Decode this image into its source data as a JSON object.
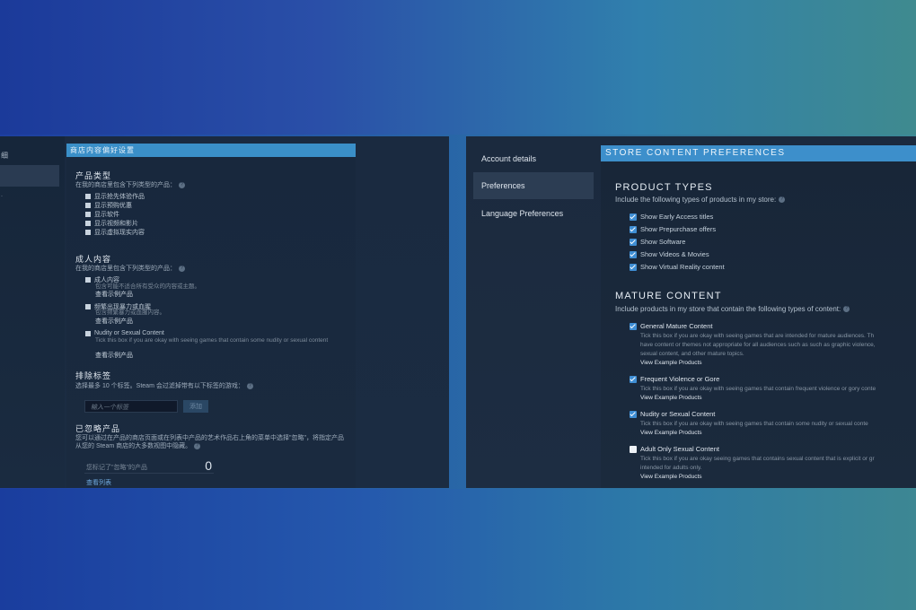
{
  "left_panel": {
    "sidebar_frags": [
      "细",
      "",
      ""
    ],
    "header": "商店内容偏好设置",
    "product_types": {
      "title": "产品类型",
      "subtitle": "在我的商店里包含下列类型的产品：",
      "items": [
        "显示抢先体验作品",
        "显示预购优惠",
        "显示软件",
        "显示视频和影片",
        "显示虚拟现实内容"
      ]
    },
    "mature": {
      "title": "成人内容",
      "subtitle": "在我的商店里包含下列类型的产品：",
      "items": [
        {
          "label": "成人内容",
          "desc": "包含可能不适合所有受众的内容或主题。",
          "link": "查看示例产品"
        },
        {
          "label": "频繁出现暴力或血腥",
          "desc": "包含频繁暴力或血腥内容。",
          "link": "查看示例产品"
        },
        {
          "label": "Nudity or Sexual Content",
          "desc": "Tick this box if you are okay with seeing games that contain some nudity or sexual content",
          "link": "查看示例产品"
        }
      ]
    },
    "excluded_tags": {
      "title": "排除标签",
      "subtitle": "选择最多 10 个标签。Steam 会过滤掉带有以下标签的游戏：",
      "input_placeholder": "输入一个标签",
      "add_button": "添加"
    },
    "ignored": {
      "title": "已忽略产品",
      "desc": "您可以通过在产品的商店页面或在列表中产品的艺术作品右上角的菜单中选择\"忽略\"，将指定产品从您的 Steam 商店的大多数视图中隐藏。",
      "label": "您标记了\"忽略\"的产品",
      "count": "0",
      "view_list": "查看列表"
    }
  },
  "right_panel": {
    "sidebar": [
      "Account details",
      "Preferences",
      "Language Preferences"
    ],
    "header": "STORE CONTENT PREFERENCES",
    "product_types": {
      "title": "PRODUCT TYPES",
      "subtitle": "Include the following types of products in my store:",
      "items": [
        "Show Early Access titles",
        "Show Prepurchase offers",
        "Show Software",
        "Show Videos & Movies",
        "Show Virtual Reality content"
      ]
    },
    "mature": {
      "title": "MATURE CONTENT",
      "subtitle": "Include products in my store that contain the following types of content:",
      "items": [
        {
          "label": "General Mature Content",
          "desc1": "Tick this box if you are okay with seeing games that are intended for mature audiences. Th",
          "desc2": "have content or themes not appropriate for all audiences such as such as graphic violence,",
          "desc3": "sexual content, and other mature topics.",
          "link": "View Example Products",
          "checked": true
        },
        {
          "label": "Frequent Violence or Gore",
          "desc1": "Tick this box if you are okay with seeing games that contain frequent violence or gory conte",
          "link": "View Example Products",
          "checked": true
        },
        {
          "label": "Nudity or Sexual Content",
          "desc1": "Tick this box if you are okay with seeing games that contain some nudity or sexual conte",
          "link": "View Example Products",
          "checked": true
        },
        {
          "label": "Adult Only Sexual Content",
          "desc1": "Tick this box if you are okay seeing games that contains sexual content that is explicit or gr",
          "desc2": "intended for adults only.",
          "link": "View Example Products",
          "checked": false
        }
      ]
    }
  },
  "colors": {
    "header_blue": "#3d8fcb",
    "checkbox_blue": "#3f8ed4",
    "panel_bg": "#1b2a3e"
  }
}
